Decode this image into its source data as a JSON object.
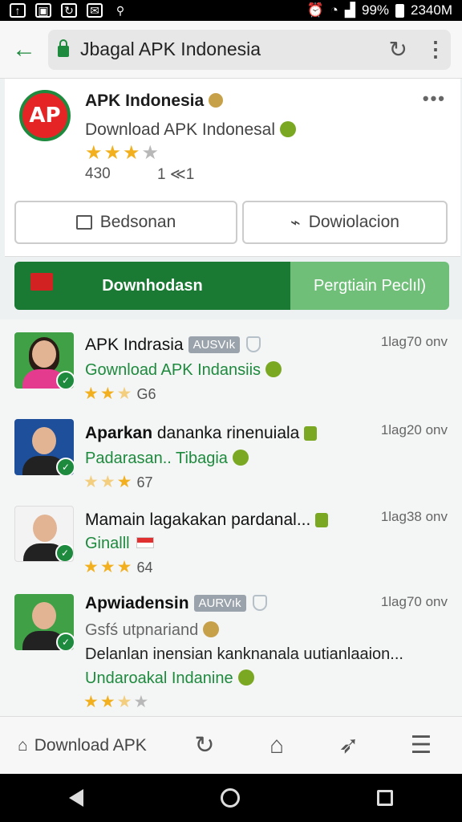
{
  "status_bar": {
    "battery": "99%",
    "time": "2340M",
    "icons": [
      "upload-icon",
      "image-icon",
      "sync-icon",
      "message-icon",
      "vpn-icon",
      "alarm-icon",
      "wifi-icon",
      "signal-icon",
      "battery-icon"
    ]
  },
  "browser": {
    "url": "Jbagal APK Indonesia"
  },
  "app": {
    "logo_text": "AP",
    "name": "APK Indonesia",
    "subtitle": "Download APK Indonesal",
    "rating": 3,
    "rating_max": 4,
    "count": "430",
    "count2": "1 ≪1",
    "btn_left": "Bedsonan",
    "btn_right": "Dowiolacion"
  },
  "banner": {
    "left_label": "Downhodasn",
    "right_label": "Pergtiain Peclıl)"
  },
  "list": [
    {
      "title": "APK Indrasia",
      "tag": "AUSVık",
      "time": "1lag70 onv",
      "sub": "Gownload APK Indansiis",
      "rating": 2.5,
      "count": "G6"
    },
    {
      "title": "Aparkan",
      "title_rest": " dananka rinenuiala",
      "time": "1lag20 onv",
      "sub": "Padarasan.. Tibagia",
      "rating": 2,
      "count": "67"
    },
    {
      "title": "Mamain lagakakan pardanal...",
      "time": "1lag38 onv",
      "sub": "Ginalll",
      "rating": 3,
      "count": "64"
    },
    {
      "title": "Apwiadensin",
      "tag": "AURVık",
      "time": "1lag70 onv",
      "sub": "Gsfś utpnariand",
      "desc": "Delanlan inensian kanknanala uutianlaaion...",
      "sub2": "Undaroakal Indanine",
      "rating": 2.5
    }
  ],
  "bottom_bar": {
    "download_label": "Download APK"
  },
  "colors": {
    "brand_green": "#1a7a34",
    "light_green": "#6fbf79",
    "star": "#f2b01e"
  }
}
